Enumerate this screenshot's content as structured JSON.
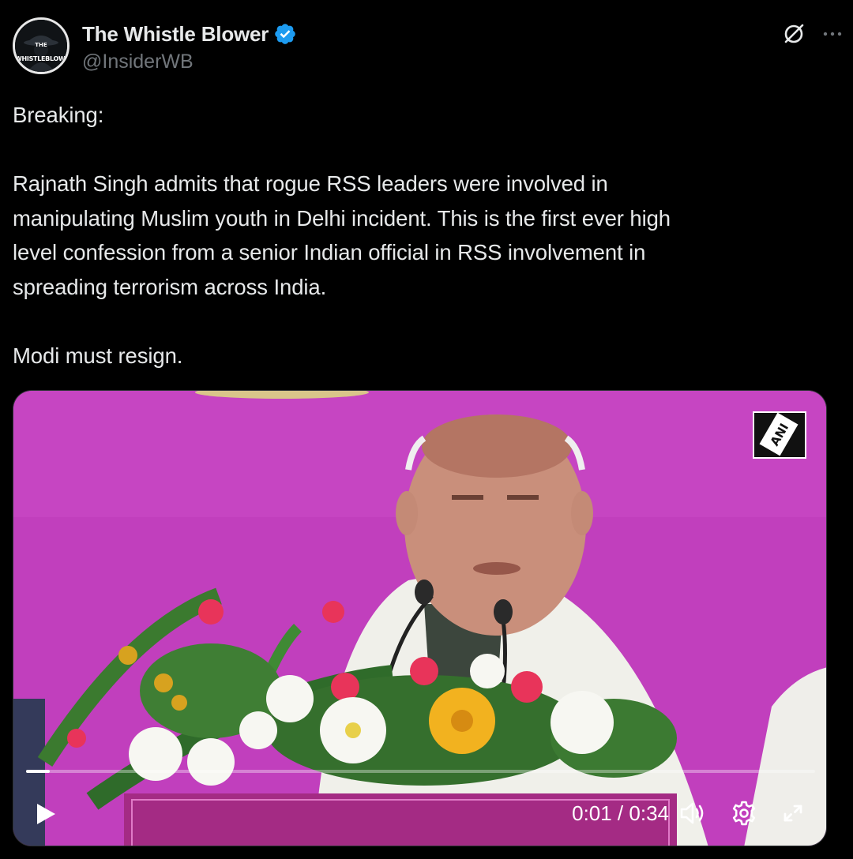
{
  "author": {
    "display_name": "The Whistle Blower",
    "handle": "@InsiderWB",
    "avatar_text_top": "THE",
    "avatar_text_bottom": "WHISTLEBLOWER",
    "verified_color": "#1d9bf0"
  },
  "tweet": {
    "text": "Breaking:\n\nRajnath Singh admits that rogue RSS leaders were involved in\nmanipulating Muslim youth in Delhi incident. This is the first ever high\nlevel confession from a senior Indian official in RSS involvement in\nspreading terrorism across India.\n\nModi must resign."
  },
  "media": {
    "type": "video",
    "watermark": "ANI",
    "current_time": "0:01",
    "duration": "0:34",
    "time_display": "0:01 / 0:34",
    "progress": 0.03,
    "background_color": "#c13fbd"
  },
  "icons": {
    "grok": "grok-icon",
    "more": "more-icon",
    "play": "play-icon",
    "volume": "volume-icon",
    "settings": "gear-icon",
    "fullscreen": "fullscreen-icon"
  }
}
